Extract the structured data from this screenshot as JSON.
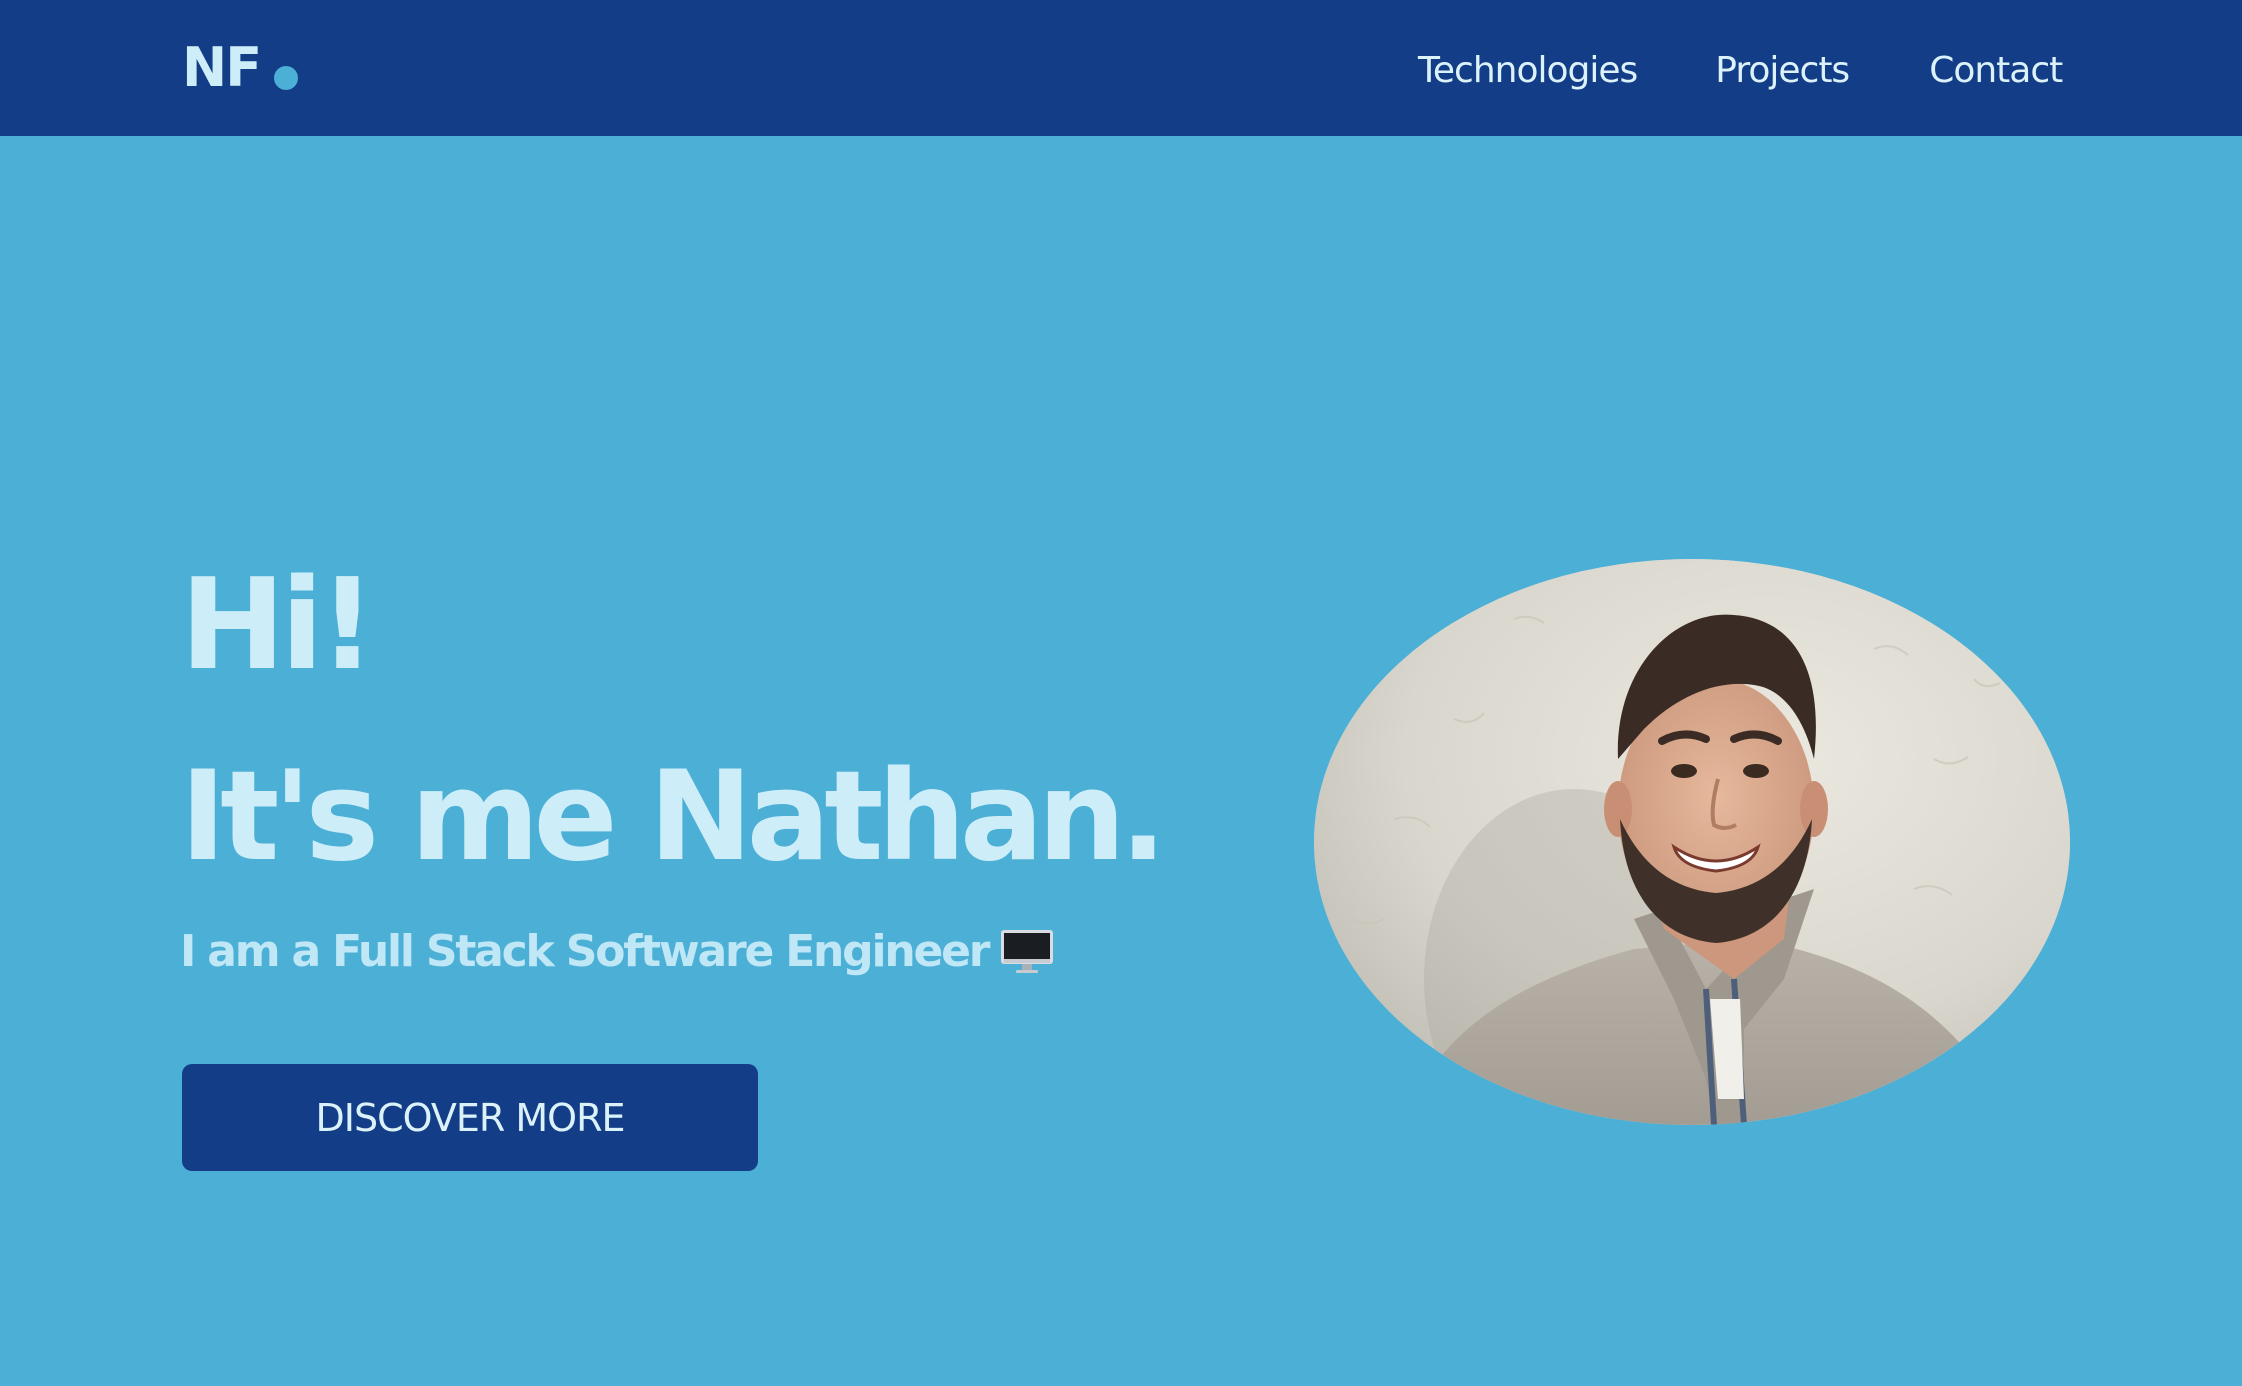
{
  "header": {
    "logo_text": "NF",
    "nav": [
      {
        "label": "Technologies"
      },
      {
        "label": "Projects"
      },
      {
        "label": "Contact"
      }
    ]
  },
  "hero": {
    "greeting": "Hi!",
    "intro": "It's me Nathan.",
    "subtitle": "I am a Full Stack Software Engineer",
    "subtitle_icon": "desktop-computer-icon",
    "cta_label": "DISCOVER MORE",
    "photo": "portrait-photo"
  },
  "colors": {
    "navbar": "#133e87",
    "background": "#4cafd6",
    "heading_text": "#cdeef9",
    "button": "#133e87"
  }
}
